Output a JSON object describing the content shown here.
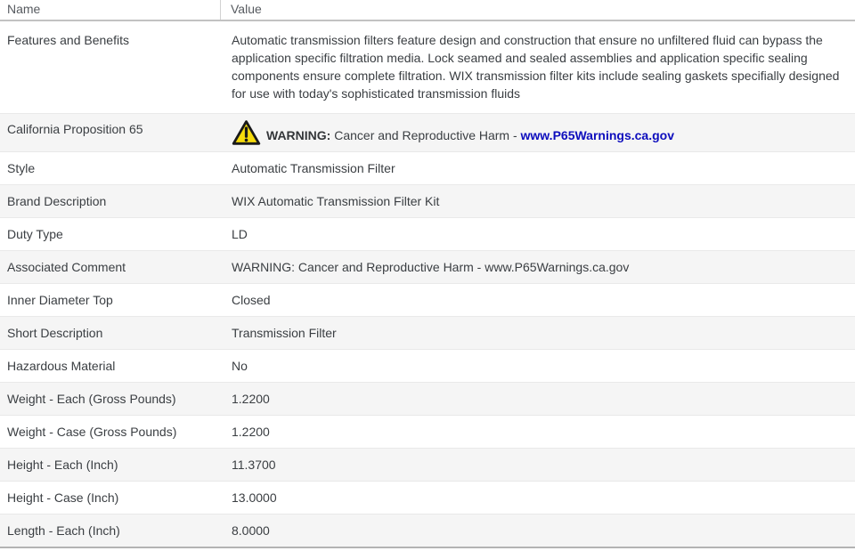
{
  "table": {
    "columns": {
      "name": "Name",
      "value": "Value"
    },
    "rows": [
      {
        "name": "Features and Benefits",
        "value": "Automatic transmission filters feature design and construction that ensure no unfiltered fluid can bypass the application specific filtration media. Lock seamed and sealed assemblies and application specific sealing components ensure complete filtration. WIX transmission filter kits include sealing gaskets specifially designed for use with today's sophisticated transmission fluids"
      },
      {
        "name": "California Proposition 65",
        "warning_label": "WARNING:",
        "warning_text": "Cancer and Reproductive Harm -",
        "link_text": "www.P65Warnings.ca.gov"
      },
      {
        "name": "Style",
        "value": "Automatic Transmission Filter"
      },
      {
        "name": "Brand Description",
        "value": "WIX Automatic Transmission Filter Kit"
      },
      {
        "name": "Duty Type",
        "value": "LD"
      },
      {
        "name": "Associated Comment",
        "value": "WARNING: Cancer and Reproductive Harm - www.P65Warnings.ca.gov"
      },
      {
        "name": "Inner Diameter Top",
        "value": "Closed"
      },
      {
        "name": "Short Description",
        "value": "Transmission Filter"
      },
      {
        "name": "Hazardous Material",
        "value": "No"
      },
      {
        "name": "Weight - Each (Gross Pounds)",
        "value": "1.2200"
      },
      {
        "name": "Weight - Case (Gross Pounds)",
        "value": "1.2200"
      },
      {
        "name": "Height - Each (Inch)",
        "value": "11.3700"
      },
      {
        "name": "Height - Case (Inch)",
        "value": "13.0000"
      },
      {
        "name": "Length - Each (Inch)",
        "value": "8.0000"
      }
    ],
    "colors": {
      "link_blue": "#0d0dbd",
      "warning_yellow": "#f5db0c",
      "warning_outline": "#1a1a1a",
      "row_alt_gray": "#f5f5f5",
      "header_border": "#c2c2c2",
      "text": "#3a3e42"
    }
  }
}
